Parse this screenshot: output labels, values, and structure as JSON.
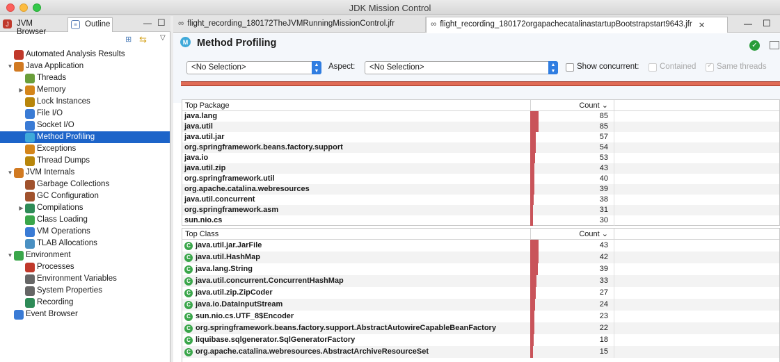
{
  "window": {
    "title": "JDK Mission Control"
  },
  "left_tabs": {
    "jvm_browser": "JVM Browser",
    "outline": "Outline"
  },
  "tree": [
    {
      "label": "Automated Analysis Results",
      "indent": 0,
      "twisty": "",
      "icon": "analysis-icon",
      "color": "#c0392b"
    },
    {
      "label": "Java Application",
      "indent": 0,
      "twisty": "▼",
      "icon": "java-app-icon",
      "color": "#d17a22"
    },
    {
      "label": "Threads",
      "indent": 1,
      "twisty": "",
      "icon": "threads-icon",
      "color": "#6a9e3a"
    },
    {
      "label": "Memory",
      "indent": 1,
      "twisty": "▶",
      "icon": "memory-icon",
      "color": "#d4851a"
    },
    {
      "label": "Lock Instances",
      "indent": 1,
      "twisty": "",
      "icon": "lock-icon",
      "color": "#b8860b"
    },
    {
      "label": "File I/O",
      "indent": 1,
      "twisty": "",
      "icon": "file-io-icon",
      "color": "#3a7bd5"
    },
    {
      "label": "Socket I/O",
      "indent": 1,
      "twisty": "",
      "icon": "socket-io-icon",
      "color": "#3a7bd5"
    },
    {
      "label": "Method Profiling",
      "indent": 1,
      "twisty": "",
      "icon": "method-profiling-icon",
      "color": "#3fa9d9",
      "selected": true
    },
    {
      "label": "Exceptions",
      "indent": 1,
      "twisty": "",
      "icon": "exceptions-icon",
      "color": "#d4851a"
    },
    {
      "label": "Thread Dumps",
      "indent": 1,
      "twisty": "",
      "icon": "thread-dumps-icon",
      "color": "#b8860b"
    },
    {
      "label": "JVM Internals",
      "indent": 0,
      "twisty": "▼",
      "icon": "jvm-internals-icon",
      "color": "#d17a22"
    },
    {
      "label": "Garbage Collections",
      "indent": 1,
      "twisty": "",
      "icon": "gc-icon",
      "color": "#a0522d"
    },
    {
      "label": "GC Configuration",
      "indent": 1,
      "twisty": "",
      "icon": "gc-config-icon",
      "color": "#a0522d"
    },
    {
      "label": "Compilations",
      "indent": 1,
      "twisty": "▶",
      "icon": "compilations-icon",
      "color": "#2e8b57"
    },
    {
      "label": "Class Loading",
      "indent": 1,
      "twisty": "",
      "icon": "class-loading-icon",
      "color": "#3aa64a"
    },
    {
      "label": "VM Operations",
      "indent": 1,
      "twisty": "",
      "icon": "vm-operations-icon",
      "color": "#3a7bd5"
    },
    {
      "label": "TLAB Allocations",
      "indent": 1,
      "twisty": "",
      "icon": "tlab-icon",
      "color": "#4a90c2"
    },
    {
      "label": "Environment",
      "indent": 0,
      "twisty": "▼",
      "icon": "environment-icon",
      "color": "#3aa64a"
    },
    {
      "label": "Processes",
      "indent": 1,
      "twisty": "",
      "icon": "processes-icon",
      "color": "#c0392b"
    },
    {
      "label": "Environment Variables",
      "indent": 1,
      "twisty": "",
      "icon": "env-vars-icon",
      "color": "#666666"
    },
    {
      "label": "System Properties",
      "indent": 1,
      "twisty": "",
      "icon": "system-properties-icon",
      "color": "#666666"
    },
    {
      "label": "Recording",
      "indent": 1,
      "twisty": "",
      "icon": "recording-icon",
      "color": "#2e8b57"
    },
    {
      "label": "Event Browser",
      "indent": 0,
      "twisty": "",
      "icon": "event-browser-icon",
      "color": "#3a7bd5"
    }
  ],
  "editor_tabs": [
    {
      "label": "flight_recording_180172TheJVMRunningMissionControl.jfr"
    },
    {
      "label": "flight_recording_180172orgapachecatalinastartupBootstrapstart9643.jfr"
    }
  ],
  "page": {
    "title": "Method Profiling",
    "selection_combo": "<No Selection>",
    "aspect_label": "Aspect:",
    "aspect_combo": "<No Selection>",
    "show_concurrent": "Show concurrent:",
    "contained": "Contained",
    "same_threads": "Same threads"
  },
  "top_package": {
    "header": "Top Package",
    "count_header": "Count ⌄",
    "max": 85,
    "rows": [
      {
        "name": "java.lang",
        "count": 85
      },
      {
        "name": "java.util",
        "count": 85
      },
      {
        "name": "java.util.jar",
        "count": 57
      },
      {
        "name": "org.springframework.beans.factory.support",
        "count": 54
      },
      {
        "name": "java.io",
        "count": 53
      },
      {
        "name": "java.util.zip",
        "count": 43
      },
      {
        "name": "org.springframework.util",
        "count": 40
      },
      {
        "name": "org.apache.catalina.webresources",
        "count": 39
      },
      {
        "name": "java.util.concurrent",
        "count": 38
      },
      {
        "name": "org.springframework.asm",
        "count": 31
      },
      {
        "name": "sun.nio.cs",
        "count": 30
      }
    ]
  },
  "top_class": {
    "header": "Top Class",
    "count_header": "Count ⌄",
    "max": 43,
    "rows": [
      {
        "name": "java.util.jar.JarFile",
        "count": 43
      },
      {
        "name": "java.util.HashMap",
        "count": 42
      },
      {
        "name": "java.lang.String",
        "count": 39
      },
      {
        "name": "java.util.concurrent.ConcurrentHashMap",
        "count": 33
      },
      {
        "name": "java.util.zip.ZipCoder",
        "count": 27
      },
      {
        "name": "java.io.DataInputStream",
        "count": 24
      },
      {
        "name": "sun.nio.cs.UTF_8$Encoder",
        "count": 23
      },
      {
        "name": "org.springframework.beans.factory.support.AbstractAutowireCapableBeanFactory",
        "count": 22
      },
      {
        "name": "liquibase.sqlgenerator.SqlGeneratorFactory",
        "count": 18
      },
      {
        "name": "org.apache.catalina.webresources.AbstractArchiveResourceSet",
        "count": 15
      }
    ]
  }
}
